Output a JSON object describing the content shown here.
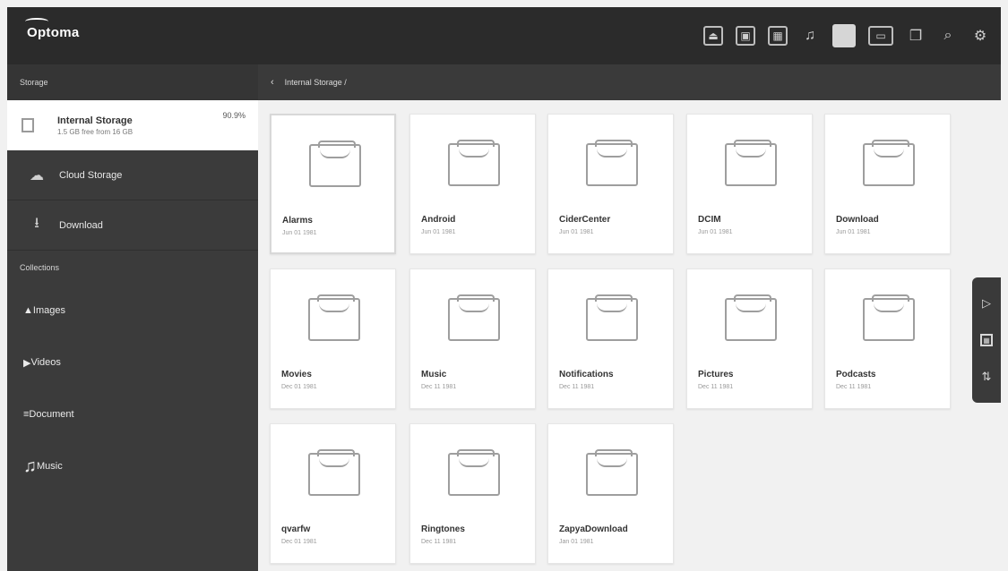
{
  "app": {
    "logo": "Optoma"
  },
  "topbar": {
    "icons": [
      {
        "name": "input-source-icon",
        "glyph": "⏏"
      },
      {
        "name": "screen-icon",
        "glyph": "▣"
      },
      {
        "name": "apps-icon",
        "glyph": "▦"
      },
      {
        "name": "music-icon",
        "glyph": "♫"
      },
      {
        "name": "file-manager-icon",
        "glyph": ""
      },
      {
        "name": "display-icon",
        "glyph": "▭"
      },
      {
        "name": "copy-icon",
        "glyph": "❐"
      },
      {
        "name": "search-icon",
        "glyph": "⌕"
      },
      {
        "name": "settings-icon",
        "glyph": "⚙"
      }
    ]
  },
  "sidebar": {
    "storage_label": "Storage",
    "internal": {
      "name": "Internal Storage",
      "sub": "1.5 GB free from 16 GB",
      "pct": "90.9%"
    },
    "cloud": {
      "label": "Cloud Storage",
      "icon": "☁"
    },
    "download": {
      "label": "Download",
      "icon": "⭳"
    },
    "collections_label": "Collections",
    "collections": [
      {
        "name": "images",
        "label": "Images",
        "icon": "▲"
      },
      {
        "name": "videos",
        "label": "Videos",
        "icon": "▶"
      },
      {
        "name": "document",
        "label": "Document",
        "icon": "≡"
      },
      {
        "name": "music",
        "label": "Music",
        "icon": "♫"
      }
    ]
  },
  "path": {
    "back": "‹",
    "current": "Internal Storage /"
  },
  "folders": [
    {
      "name": "Alarms",
      "date": "Jun 01 1981"
    },
    {
      "name": "Android",
      "date": "Jun 01 1981"
    },
    {
      "name": "CiderCenter",
      "date": "Jun 01 1981"
    },
    {
      "name": "DCIM",
      "date": "Jun 01 1981"
    },
    {
      "name": "Download",
      "date": "Jun 01 1981"
    },
    {
      "name": "Movies",
      "date": "Dec 01 1981"
    },
    {
      "name": "Music",
      "date": "Dec 11 1981"
    },
    {
      "name": "Notifications",
      "date": "Dec 11 1981"
    },
    {
      "name": "Pictures",
      "date": "Dec 11 1981"
    },
    {
      "name": "Podcasts",
      "date": "Dec 11 1981"
    },
    {
      "name": "qvarfw",
      "date": "Dec 01 1981"
    },
    {
      "name": "Ringtones",
      "date": "Dec 11 1981"
    },
    {
      "name": "ZapyaDownload",
      "date": "Jan 01 1981"
    }
  ],
  "fab": [
    {
      "name": "new-folder-icon",
      "glyph": "▷"
    },
    {
      "name": "select-all-icon",
      "glyph": "▦"
    },
    {
      "name": "sort-icon",
      "glyph": "⇅"
    }
  ]
}
